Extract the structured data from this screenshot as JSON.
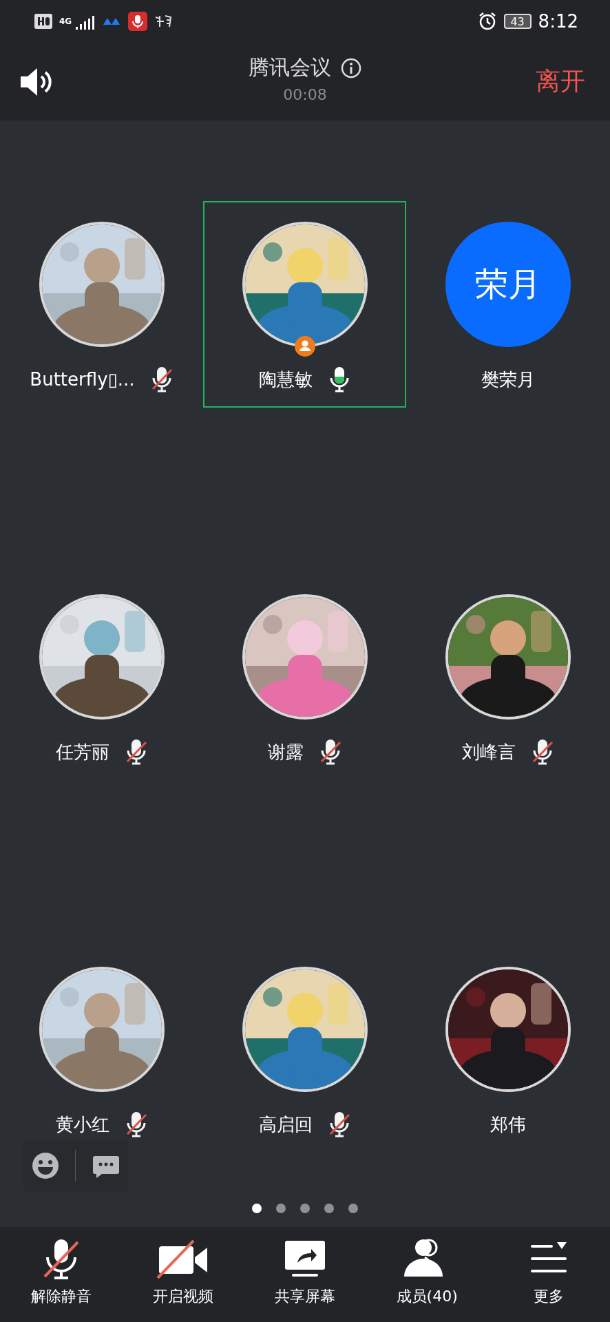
{
  "status_bar": {
    "network": "4G",
    "battery": "43",
    "time": "8:12"
  },
  "header": {
    "title": "腾讯会议",
    "timer": "00:08",
    "leave": "离开"
  },
  "participants": [
    {
      "name": "Butterfly▯...",
      "mic_shown": true,
      "muted": true,
      "speaking": false,
      "selected": false,
      "host": false
    },
    {
      "name": "陶慧敏",
      "mic_shown": true,
      "muted": false,
      "speaking": true,
      "selected": true,
      "host": true
    },
    {
      "name": "樊荣月",
      "mic_shown": false,
      "selected": false,
      "host": false,
      "avatar": {
        "kind": "initials",
        "text": "荣月",
        "color": "#0a6cff"
      }
    },
    {
      "name": "任芳丽",
      "mic_shown": true,
      "muted": true,
      "speaking": false,
      "selected": false,
      "host": false
    },
    {
      "name": "谢露",
      "mic_shown": true,
      "muted": true,
      "speaking": false,
      "selected": false,
      "host": false
    },
    {
      "name": "刘峰言",
      "mic_shown": true,
      "muted": true,
      "speaking": false,
      "selected": false,
      "host": false
    },
    {
      "name": "黄小红",
      "mic_shown": true,
      "muted": true,
      "speaking": false,
      "selected": false,
      "host": false
    },
    {
      "name": "高启回",
      "mic_shown": true,
      "muted": true,
      "speaking": false,
      "selected": false,
      "host": false
    },
    {
      "name": "郑伟",
      "mic_shown": false,
      "selected": false,
      "host": false
    }
  ],
  "pages": [
    {
      "selected": true
    },
    {
      "selected": false
    },
    {
      "selected": false
    },
    {
      "selected": false
    },
    {
      "selected": false
    }
  ],
  "toolbar": [
    {
      "kind": "mic",
      "label": "解除静音"
    },
    {
      "kind": "video",
      "label": "开启视频"
    },
    {
      "kind": "share",
      "label": "共享屏幕"
    },
    {
      "kind": "members",
      "label": "成员(40)"
    },
    {
      "kind": "more",
      "label": "更多"
    }
  ]
}
